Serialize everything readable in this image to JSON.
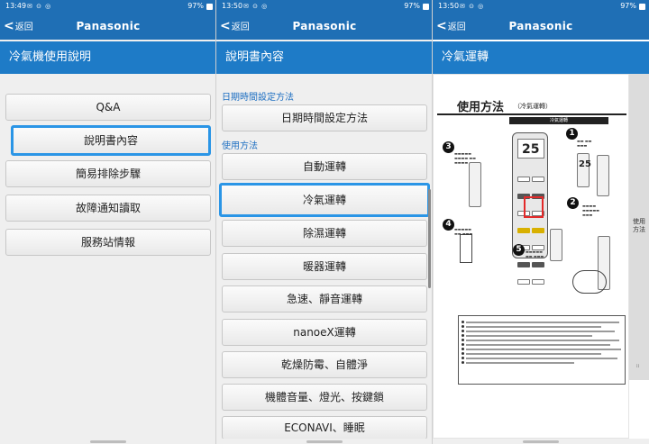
{
  "panels": [
    {
      "status": {
        "time": "13:49",
        "battery": "97%"
      },
      "appbar": {
        "back": "返回",
        "brand": "Panasonic"
      },
      "title": "冷氣機使用說明",
      "buttons": [
        "Q&A",
        "說明書內容",
        "簡易排除步驟",
        "故障通知讀取",
        "服務站情報"
      ],
      "highlighted_index": 1
    },
    {
      "status": {
        "time": "13:50",
        "battery": "97%"
      },
      "appbar": {
        "back": "返回",
        "brand": "Panasonic"
      },
      "title": "說明書內容",
      "sections": [
        {
          "heading": "日期時間設定方法",
          "items": [
            "日期時間設定方法"
          ]
        },
        {
          "heading": "使用方法",
          "items": [
            "自動運轉",
            "冷氣運轉",
            "除濕運轉",
            "暖器運轉",
            "急速、靜音運轉",
            "nanoeX運轉",
            "乾燥防霉、自體淨",
            "機體音量、燈光、按鍵鎖",
            "ECONAVI、睡眠"
          ]
        }
      ],
      "highlighted_item": "冷氣運轉"
    },
    {
      "status": {
        "time": "13:50",
        "battery": "97%"
      },
      "appbar": {
        "back": "返回",
        "brand": "Panasonic"
      },
      "title": "冷氣運轉",
      "manual": {
        "heading": "使用方法",
        "subheading": "（冷氣運轉）",
        "caption": "冷氣運轉",
        "screen_temp_main": "25",
        "screen_temp_side": "25",
        "step_numbers": [
          "1",
          "2",
          "3",
          "4",
          "5"
        ],
        "side_tab": "使用方法"
      }
    }
  ],
  "colors": {
    "appbar": "#1f6fb5",
    "titlebar": "#1e7bc7",
    "highlight": "#2a95e6",
    "section": "#1e6fc2"
  }
}
